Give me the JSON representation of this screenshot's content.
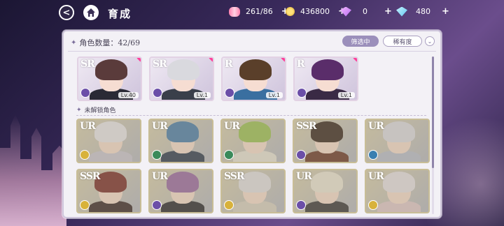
{
  "header": {
    "back_label": "<",
    "title": "育成"
  },
  "resources": [
    {
      "icon": "candy-icon",
      "value": "261/86",
      "plus": "+"
    },
    {
      "icon": "coin-icon",
      "value": "436800",
      "plus": "+"
    },
    {
      "icon": "purple-gem-icon",
      "value": "0",
      "plus": "+"
    },
    {
      "icon": "blue-gem-icon",
      "value": "480",
      "plus": "+"
    }
  ],
  "panel": {
    "count_label": "角色数量：42/69",
    "filter_label": "筛选中",
    "rarity_label": "稀有度",
    "sort_label": "⌄",
    "locked_section_title": "未解锁角色"
  },
  "owned_cards": [
    {
      "rarity": "SR",
      "level": "Lv.40",
      "hair": "#5a3b3b",
      "outfit": "#2a2a35",
      "elem": "#6b4fa8"
    },
    {
      "rarity": "SR",
      "level": "Lv.1",
      "hair": "#d9d9de",
      "outfit": "#3a3f4a",
      "elem": "#6b4fa8"
    },
    {
      "rarity": "R",
      "level": "Lv.1",
      "hair": "#5a3f2a",
      "outfit": "#3a6fa0",
      "elem": "#6b4fa8"
    },
    {
      "rarity": "R",
      "level": "Lv.1",
      "hair": "#5a2d6a",
      "outfit": "#3a2a45",
      "elem": "#6b4fa8"
    }
  ],
  "locked_cards": [
    {
      "rarity": "UR",
      "hair": "#e8e6ee",
      "outfit": "#c9c6d6",
      "elem": "#d8b23a"
    },
    {
      "rarity": "UR",
      "hair": "#4a7fb0",
      "outfit": "#2f3d55",
      "elem": "#3a8a5a"
    },
    {
      "rarity": "UR",
      "hair": "#9cc25a",
      "outfit": "#e6e3da",
      "elem": "#3a8a5a"
    },
    {
      "rarity": "SSR",
      "hair": "#3a2a25",
      "outfit": "#6a3a2f",
      "elem": "#6b4fa8"
    },
    {
      "rarity": "UR",
      "hair": "#dcdce6",
      "outfit": "#b9bfd2",
      "elem": "#3a7fb0"
    },
    {
      "rarity": "SSR",
      "hair": "#7a2f2f",
      "outfit": "#3a2a2f",
      "elem": "#d8b23a"
    },
    {
      "rarity": "UR",
      "hair": "#9a6aa8",
      "outfit": "#2a2a35",
      "elem": "#6b4fa8"
    },
    {
      "rarity": "SSR",
      "hair": "#e2e0e6",
      "outfit": "#d8d2c6",
      "elem": "#d8b23a"
    },
    {
      "rarity": "UR",
      "hair": "#ece6da",
      "outfit": "#3a3a40",
      "elem": "#6b4fa8"
    },
    {
      "rarity": "UR",
      "hair": "#e6e2ea",
      "outfit": "#e0c9cf",
      "elem": "#d8b23a"
    }
  ]
}
